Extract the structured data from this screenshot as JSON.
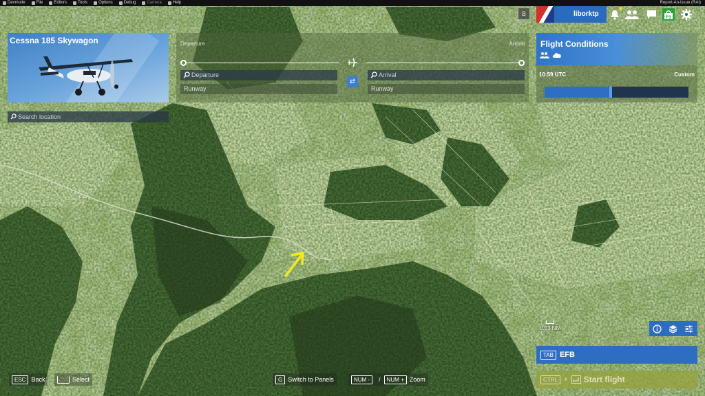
{
  "devbar": {
    "items": [
      {
        "label": "Devmode",
        "icon": "devmode-icon"
      },
      {
        "label": "File",
        "icon": "folder-icon"
      },
      {
        "label": "Editors",
        "icon": "pencil-icon"
      },
      {
        "label": "Tools",
        "icon": "wrench-icon"
      },
      {
        "label": "Options",
        "icon": "gear-icon"
      },
      {
        "label": "Debug",
        "icon": "code-icon"
      },
      {
        "label": "Camera",
        "icon": "camera-icon"
      },
      {
        "label": "Help",
        "icon": "help-icon"
      }
    ],
    "right_label": "Report-An-Issue (RAI)"
  },
  "aircraft": {
    "name": "Cessna 185 Skywagon",
    "colors": {
      "bg": "#4f8fd2"
    }
  },
  "search_location": {
    "placeholder": "Search location"
  },
  "flight_plan": {
    "departure_label": "Departure",
    "arrival_label": "Arrival",
    "departure_dash": "-",
    "arrival_dash": "-",
    "departure_placeholder": "Departure",
    "arrival_placeholder": "Arrival",
    "departure_runway": "Runway",
    "arrival_runway": "Runway",
    "swap_icon": "swap-arrows-icon"
  },
  "flight_conditions": {
    "title": "Flight Conditions",
    "time": "10:59 UTC",
    "mode": "Custom",
    "time_of_day_fraction": 0.46
  },
  "user": {
    "b_label": "B",
    "username": "liborktp",
    "accent": "#2b6bbd"
  },
  "map": {
    "scale_label": "0.03 NM"
  },
  "efb": {
    "key": "TAB",
    "label": "EFB"
  },
  "start_flight": {
    "key": "CTRL",
    "plus": "+",
    "label": "Start flight"
  },
  "hints": {
    "back_key": "ESC",
    "back_label": "Back",
    "select_label": "Select",
    "panels_key": "G",
    "panels_label": "Switch to Panels",
    "zoom_out_key": "NUM -",
    "zoom_sep": "/",
    "zoom_in_key": "NUM +",
    "zoom_label": "Zoom"
  }
}
